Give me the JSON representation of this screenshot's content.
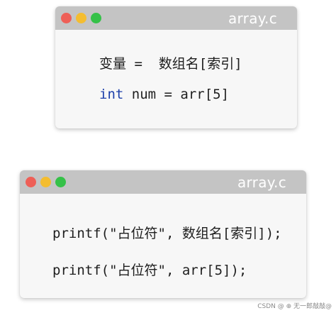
{
  "colors": {
    "red": "#ee5f57",
    "yellow": "#f4bd30",
    "green": "#35c148",
    "titlebar": "#c4c4c4",
    "keyword": "#1c3faa"
  },
  "windows": [
    {
      "title": "array.c",
      "lines": [
        {
          "text": "变量 =  数组名[索引]"
        },
        {
          "keyword": "int",
          "rest": " num = arr[5]"
        }
      ]
    },
    {
      "title": "array.c",
      "lines": [
        {
          "text": "printf(\"占位符\", 数组名[索引]);"
        },
        {
          "text": "printf(\"占位符\", arr[5]);"
        }
      ]
    }
  ],
  "watermark": "CSDN @ ⊕ 无一郎敲敲@"
}
